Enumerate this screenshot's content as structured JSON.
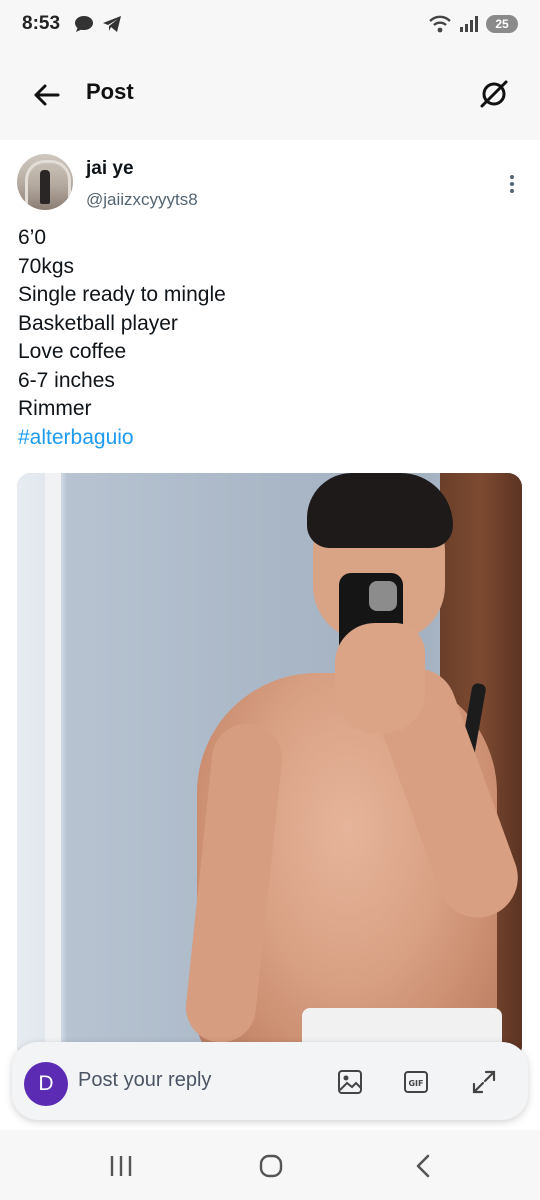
{
  "status_bar": {
    "time": "8:53",
    "battery": "25",
    "left_icons": [
      "chat-bubble-icon",
      "telegram-icon"
    ],
    "right_icons": [
      "wifi-icon",
      "signal-icon",
      "battery-icon"
    ]
  },
  "header": {
    "title": "Post",
    "back_icon": "arrow-left-icon",
    "grok_icon": "grok-icon"
  },
  "post": {
    "author": {
      "display_name": "jai ye",
      "handle": "@jaiizxcyyyts8"
    },
    "lines": [
      "6’0",
      "70kgs",
      "Single ready to mingle",
      "Basketball player",
      "Love coffee",
      "6-7 inches",
      "Rimmer"
    ],
    "hashtag": "#alterbaguio",
    "media_alt": "Mirror selfie photo"
  },
  "reply": {
    "avatar_letter": "D",
    "placeholder": "Post your reply",
    "avatar_color": "#5b2bb3",
    "icons": [
      "image-icon",
      "gif-icon",
      "expand-icon"
    ]
  },
  "colors": {
    "link": "#1d9bf0",
    "text": "#0f1419",
    "muted": "#536471"
  },
  "system_nav": {
    "icons": [
      "recent-apps-icon",
      "home-icon",
      "back-icon"
    ]
  }
}
